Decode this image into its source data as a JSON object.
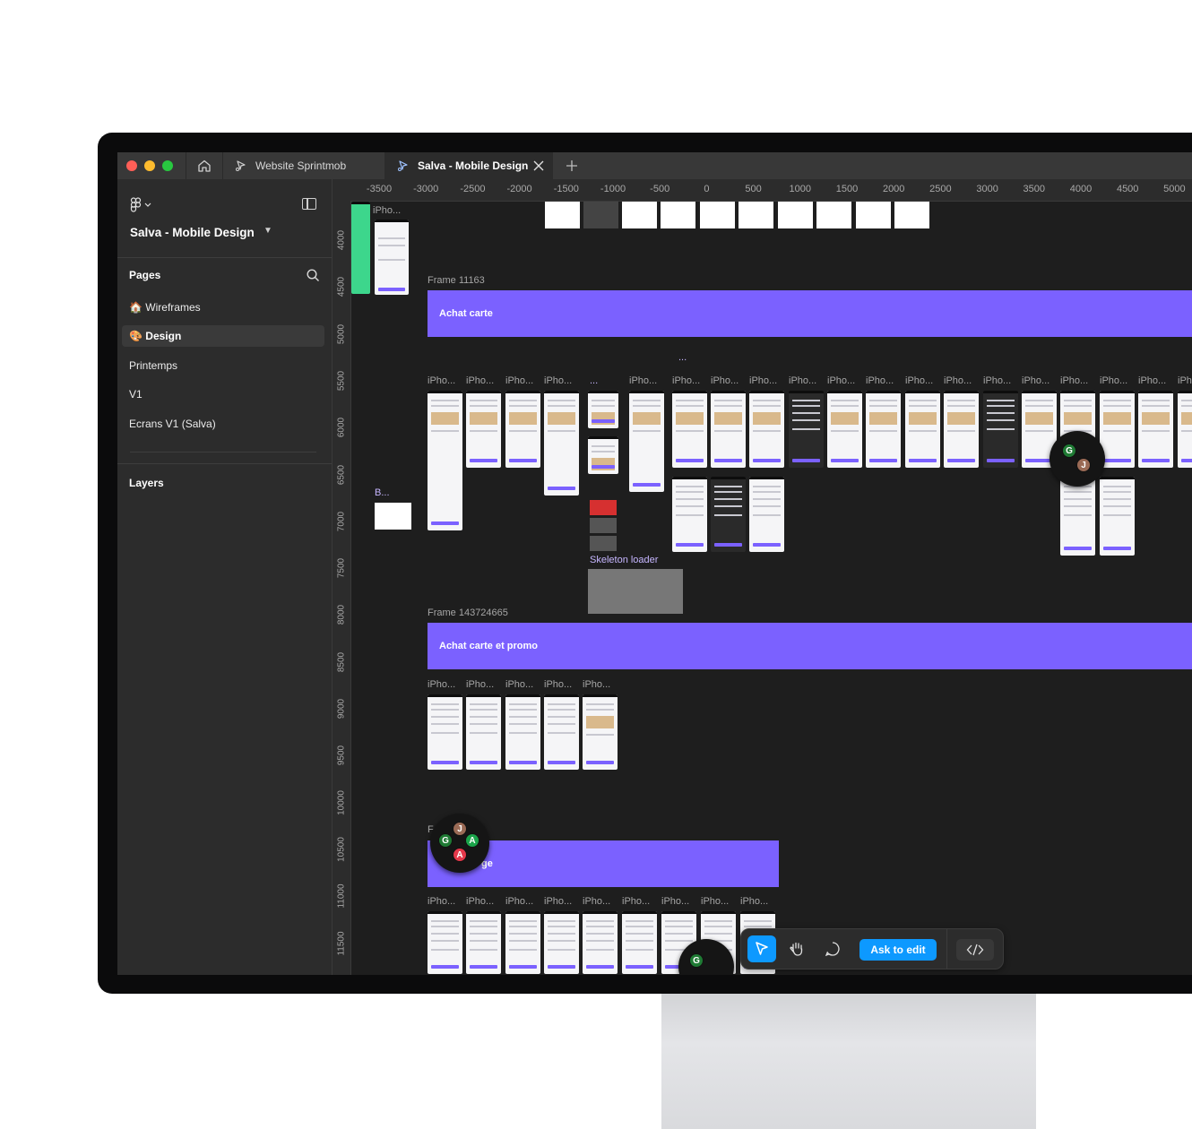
{
  "tabs": {
    "home_icon": "home-icon",
    "items": [
      {
        "label": "Website Sprintmob",
        "icon": "figma-file-icon"
      },
      {
        "label": "Salva - Mobile Design",
        "icon": "figma-file-icon",
        "active": true
      }
    ],
    "new_tab_icon": "plus-icon"
  },
  "sidebar": {
    "file_title": "Salva - Mobile Design",
    "pages_title": "Pages",
    "pages": [
      {
        "label": "🏠 Wireframes"
      },
      {
        "label": "🎨 Design",
        "active": true
      },
      {
        "label": "Printemps"
      },
      {
        "label": "V1"
      },
      {
        "label": "Ecrans V1 (Salva)"
      }
    ],
    "layers_title": "Layers"
  },
  "rulers": {
    "top": [
      "-3500",
      "-3000",
      "-2500",
      "-2000",
      "-1500",
      "-1000",
      "-500",
      "0",
      "500",
      "1000",
      "1500",
      "2000",
      "2500",
      "3000",
      "3500",
      "4000",
      "4500",
      "5000"
    ],
    "left": [
      "4000",
      "4500",
      "5000",
      "5500",
      "6000",
      "6500",
      "7000",
      "7500",
      "8000",
      "8500",
      "9000",
      "9500",
      "10000",
      "10500",
      "11000",
      "11500"
    ]
  },
  "canvas": {
    "frame1_label": "Frame 11163",
    "frame1_banner": "Achat carte",
    "frame2_label": "Frame 143724665",
    "frame2_banner": "Achat carte et promo",
    "frame3_label": "F",
    "frame3_banner": "ge",
    "phone_label": "iPho...",
    "phone_label_short": "Pho...",
    "phone_label_tiny": "iPh",
    "comp_dots": "...",
    "comp_b": "B...",
    "skeleton_label": "Skeleton loader",
    "top_partial_label": "iPho..."
  },
  "collaborators": {
    "group_right": [
      "G",
      "J"
    ],
    "group_center": [
      "J",
      "G",
      "A",
      "A"
    ],
    "group_bottom": [
      "G"
    ]
  },
  "toolbar": {
    "ask_to_edit": "Ask to edit",
    "accent": "#0d99ff"
  },
  "colors": {
    "banner": "#7b61ff",
    "canvas": "#1e1e1e",
    "panel": "#2c2c2c"
  }
}
